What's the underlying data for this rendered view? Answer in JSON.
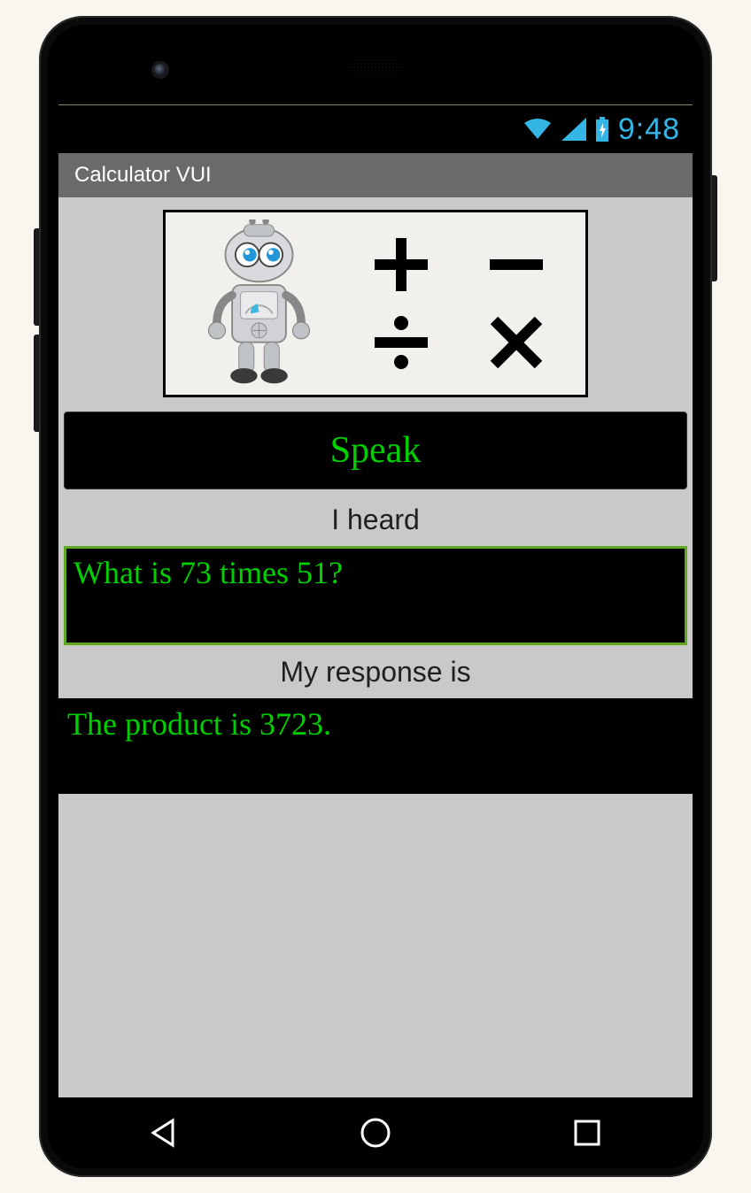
{
  "status": {
    "time": "9:48"
  },
  "app": {
    "title": "Calculator VUI"
  },
  "hero": {
    "operators": [
      "+",
      "−",
      "÷",
      "×"
    ]
  },
  "buttons": {
    "speak": "Speak"
  },
  "labels": {
    "heard": "I heard",
    "response": "My response is"
  },
  "heard_text": "What is 73 times 51?",
  "response_text": "The product is 3723.",
  "colors": {
    "accent_green": "#00d000",
    "holo_blue": "#33b5e5"
  }
}
